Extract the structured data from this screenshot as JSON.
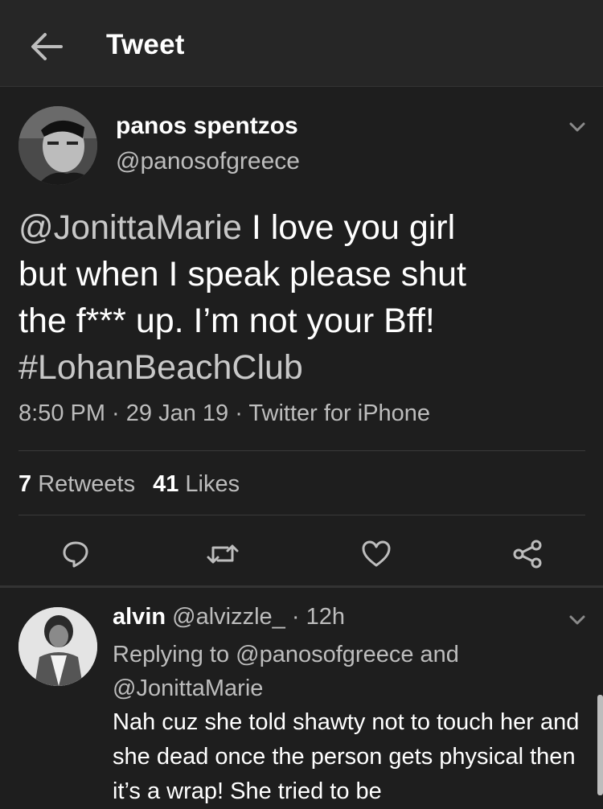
{
  "header": {
    "back_icon": "arrow-left-icon",
    "title": "Tweet"
  },
  "tweet": {
    "author_name": "panos spentzos",
    "author_handle": "@panosofgreece",
    "text_mention": "@JonittaMarie",
    "text_body_line1": " I love you girl",
    "text_body_line2": "but when I speak please shut",
    "text_body_line3": "the f*** up. I’m not your Bff!",
    "text_hashtag": "#LohanBeachClub",
    "meta": "8:50 PM · 29 Jan 19 · Twitter for iPhone",
    "retweets_count": "7",
    "retweets_label": "Retweets",
    "likes_count": "41",
    "likes_label": "Likes",
    "actions": [
      {
        "name": "reply-icon"
      },
      {
        "name": "retweet-icon"
      },
      {
        "name": "like-icon"
      },
      {
        "name": "share-icon"
      }
    ]
  },
  "reply": {
    "author_name": "alvin",
    "author_handle": "@alvizzle_",
    "time": " · 12h",
    "replying_to": "Replying to @panosofgreece and @JonittaMarie",
    "text": "Nah cuz she told shawty not to touch her and she dead once the person gets physical then it’s a wrap! She tried to be"
  },
  "colors": {
    "background": "#1e1e1e",
    "header_bg": "#262626",
    "secondary_text": "#bdbdbd",
    "primary_text": "#ffffff"
  }
}
